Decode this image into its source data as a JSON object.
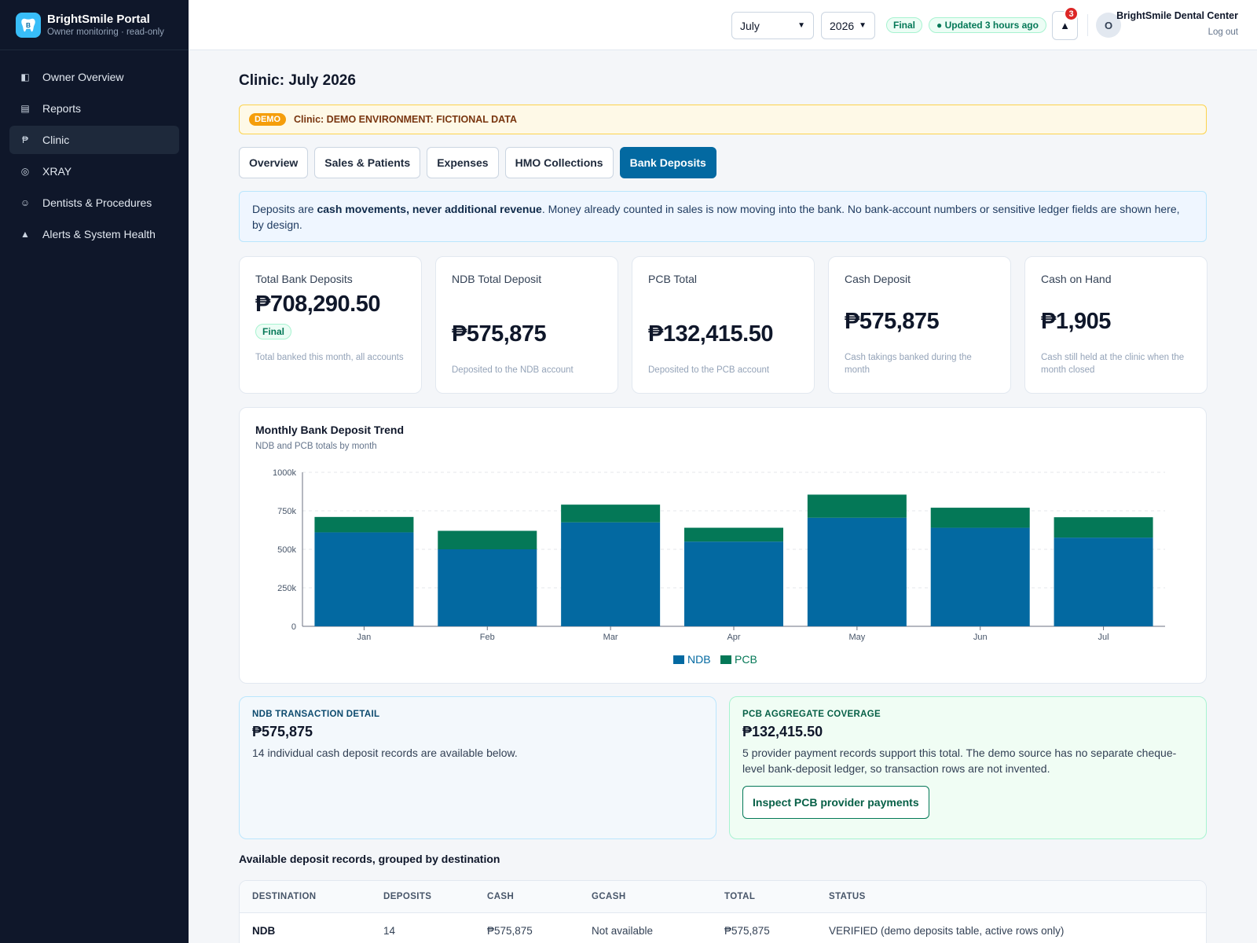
{
  "brand": {
    "title": "BrightSmile Portal",
    "subtitle": "Owner monitoring · read-only",
    "logo_icon": "tooth-logo-icon"
  },
  "sidebar": {
    "items": [
      {
        "label": "Owner Overview",
        "icon": "◧",
        "active": false
      },
      {
        "label": "Reports",
        "icon": "▤",
        "active": false
      },
      {
        "label": "Clinic",
        "icon": "₱",
        "active": true
      },
      {
        "label": "XRAY",
        "icon": "◎",
        "active": false
      },
      {
        "label": "Dentists & Procedures",
        "icon": "☺",
        "active": false
      },
      {
        "label": "Alerts & System Health",
        "icon": "▲",
        "active": false
      }
    ]
  },
  "topbar": {
    "month": "July",
    "year": "2026",
    "final_label": "Final",
    "updated_label": "● Updated 3 hours ago",
    "notification_count": "3",
    "avatar_initial": "O",
    "user_name": "BrightSmile Dental Center",
    "logout_label": "Log out"
  },
  "page": {
    "title": "Clinic: July 2026",
    "demo_tag": "DEMO",
    "demo_text": "Clinic: DEMO ENVIRONMENT: FICTIONAL DATA",
    "tabs": [
      "Overview",
      "Sales & Patients",
      "Expenses",
      "HMO Collections",
      "Bank Deposits"
    ],
    "active_tab": "Bank Deposits",
    "info_prefix": "Deposits are ",
    "info_bold": "cash movements, never additional revenue",
    "info_suffix": ". Money already counted in sales is now moving into the bank. No bank-account numbers or sensitive ledger fields are shown here, by design."
  },
  "kpis": [
    {
      "label": "Total Bank Deposits",
      "value": "₱708,290.50",
      "pill": "Final",
      "desc": "Total banked this month, all accounts"
    },
    {
      "label": "NDB Total Deposit",
      "value": "₱575,875",
      "desc": "Deposited to the NDB account"
    },
    {
      "label": "PCB Total",
      "value": "₱132,415.50",
      "desc": "Deposited to the PCB account"
    },
    {
      "label": "Cash Deposit",
      "value": "₱575,875",
      "desc": "Cash takings banked during the month"
    },
    {
      "label": "Cash on Hand",
      "value": "₱1,905",
      "desc": "Cash still held at the clinic when the month closed"
    }
  ],
  "chart": {
    "title": "Monthly Bank Deposit Trend",
    "subtitle": "NDB and PCB totals by month"
  },
  "chart_data": {
    "type": "bar",
    "stacked": true,
    "categories": [
      "Jan",
      "Feb",
      "Mar",
      "Apr",
      "May",
      "Jun",
      "Jul"
    ],
    "series": [
      {
        "name": "NDB",
        "color": "#0369a1",
        "values": [
          610000,
          500000,
          675000,
          550000,
          705000,
          640000,
          575875
        ]
      },
      {
        "name": "PCB",
        "color": "#047857",
        "values": [
          100000,
          120000,
          115000,
          90000,
          150000,
          130000,
          132415.5
        ]
      }
    ],
    "ylim": [
      0,
      1000000
    ],
    "yticks": [
      0,
      250000,
      500000,
      750000,
      1000000
    ],
    "ytick_labels": [
      "0",
      "250k",
      "500k",
      "750k",
      "1000k"
    ],
    "grid": true,
    "legend": "bottom-center"
  },
  "details": {
    "ndb": {
      "label": "NDB TRANSACTION DETAIL",
      "value": "₱575,875",
      "text": "14 individual cash deposit records are available below."
    },
    "pcb": {
      "label": "PCB AGGREGATE COVERAGE",
      "value": "₱132,415.50",
      "text": "5 provider payment records support this total. The demo source has no separate cheque-level bank-deposit ledger, so transaction rows are not invented.",
      "button": "Inspect PCB provider payments"
    }
  },
  "records": {
    "title": "Available deposit records, grouped by destination",
    "headers": [
      "DESTINATION",
      "DEPOSITS",
      "CASH",
      "GCASH",
      "TOTAL",
      "STATUS"
    ],
    "rows": [
      [
        "NDB",
        "14",
        "₱575,875",
        "Not available",
        "₱575,875",
        "VERIFIED (demo deposits table, active rows only)"
      ]
    ]
  }
}
